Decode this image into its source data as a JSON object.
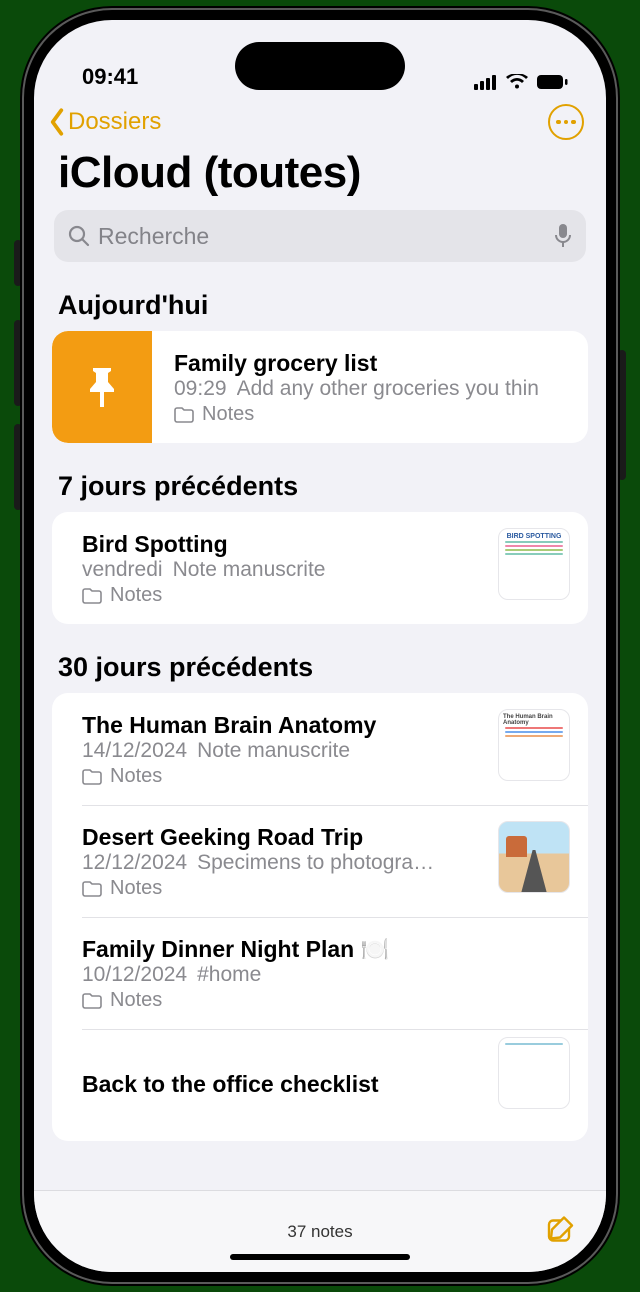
{
  "status": {
    "time": "09:41"
  },
  "nav": {
    "back_label": "Dossiers"
  },
  "page": {
    "title": "iCloud (toutes)"
  },
  "search": {
    "placeholder": "Recherche"
  },
  "sections": {
    "today": {
      "header": "Aujourd'hui"
    },
    "week": {
      "header": "7 jours précédents"
    },
    "month": {
      "header": "30 jours précédents"
    }
  },
  "notes": {
    "grocery": {
      "title": "Family grocery list",
      "time": "09:29",
      "preview": "Add any other groceries you thin",
      "folder": "Notes"
    },
    "bird": {
      "title": "Bird Spotting",
      "time": "vendredi",
      "preview": "Note manuscrite",
      "folder": "Notes"
    },
    "brain": {
      "title": "The Human Brain Anatomy",
      "time": "14/12/2024",
      "preview": "Note manuscrite",
      "folder": "Notes"
    },
    "desert": {
      "title": "Desert Geeking Road Trip",
      "time": "12/12/2024",
      "preview": "Specimens to photogra…",
      "folder": "Notes"
    },
    "dinner": {
      "title": "Family Dinner Night Plan 🍽️",
      "time": "10/12/2024",
      "preview": "#home",
      "folder": "Notes"
    },
    "office": {
      "title": "Back to the office checklist"
    }
  },
  "toolbar": {
    "count": "37 notes"
  },
  "colors": {
    "accent": "#e1a100",
    "pin": "#f39c12"
  }
}
